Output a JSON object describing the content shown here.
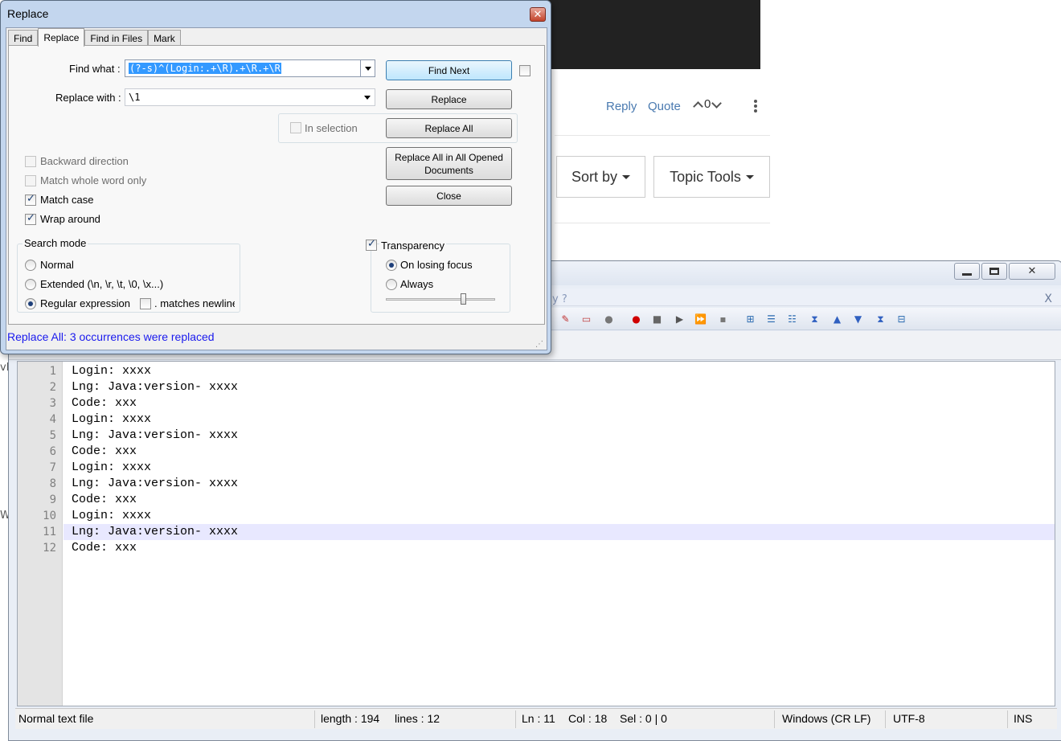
{
  "web": {
    "reply": "Reply",
    "quote": "Quote",
    "vote_count": "0",
    "sort_by": "Sort by",
    "topic_tools": "Topic Tools",
    "frag_a": "vh",
    "frag_b": "W"
  },
  "npp": {
    "menu_fragment": "y   ?",
    "menu_close": "X",
    "lines": [
      {
        "num": "1",
        "text": "Login: xxxx"
      },
      {
        "num": "2",
        "text": "Lng: Java:version- xxxx"
      },
      {
        "num": "3",
        "text": "Code: xxx"
      },
      {
        "num": "4",
        "text": "Login: xxxx"
      },
      {
        "num": "5",
        "text": "Lng: Java:version- xxxx"
      },
      {
        "num": "6",
        "text": "Code: xxx"
      },
      {
        "num": "7",
        "text": "Login: xxxx"
      },
      {
        "num": "8",
        "text": "Lng: Java:version- xxxx"
      },
      {
        "num": "9",
        "text": "Code: xxx"
      },
      {
        "num": "10",
        "text": "Login: xxxx"
      },
      {
        "num": "11",
        "text": "Lng: Java:version- xxxx"
      },
      {
        "num": "12",
        "text": "Code: xxx"
      }
    ],
    "current_line": 11,
    "status": {
      "file_type": "Normal text file",
      "length": "length : 194",
      "lines": "lines : 12",
      "ln": "Ln : 11",
      "col": "Col : 18",
      "sel": "Sel : 0 | 0",
      "eol": "Windows (CR LF)",
      "encoding": "UTF-8",
      "mode": "INS"
    }
  },
  "dialog": {
    "title": "Replace",
    "tabs": [
      "Find",
      "Replace",
      "Find in Files",
      "Mark"
    ],
    "active_tab": "Replace",
    "find_label": "Find what :",
    "find_value": "(?-s)^(Login:.+\\R).+\\R.+\\R",
    "replace_label": "Replace with :",
    "replace_value": "\\1",
    "in_selection": "In selection",
    "buttons": {
      "find_next": "Find Next",
      "replace": "Replace",
      "replace_all": "Replace All",
      "replace_all_opened_1": "Replace All in All Opened",
      "replace_all_opened_2": "Documents",
      "close": "Close"
    },
    "options": {
      "backward": "Backward direction",
      "whole_word": "Match whole word only",
      "match_case": "Match case",
      "wrap_around": "Wrap around"
    },
    "search_mode": {
      "title": "Search mode",
      "normal": "Normal",
      "extended": "Extended (\\n, \\r, \\t, \\0, \\x...)",
      "regex": "Regular expression",
      "matches_newline": ". matches newline"
    },
    "transparency": {
      "title": "Transparency",
      "on_losing_focus": "On losing focus",
      "always": "Always"
    },
    "status_message": "Replace All: 3 occurrences were replaced"
  }
}
